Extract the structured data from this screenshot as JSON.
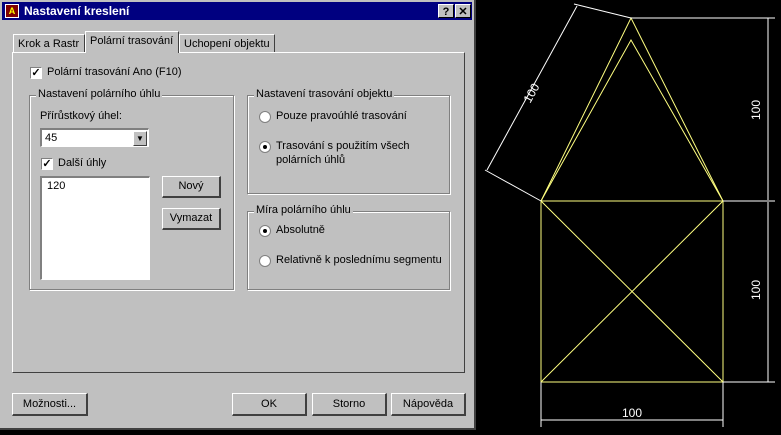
{
  "dialog": {
    "title": "Nastavení kreslení",
    "help_button": "?",
    "close_button": "✕",
    "tabs": [
      {
        "label": "Krok a Rastr",
        "active": false
      },
      {
        "label": "Polární trasování",
        "active": true
      },
      {
        "label": "Uchopení objektu",
        "active": false
      }
    ],
    "polar_tracking_on": {
      "label": "Polární trasování Ano (F10)",
      "checked": true
    },
    "polar_angle_group": {
      "title": "Nastavení polárního úhlu",
      "increment_label": "Přírůstkový úhel:",
      "increment_value": "45",
      "additional_angles": {
        "label": "Další úhly",
        "checked": true
      },
      "angles_list": [
        "120"
      ],
      "new_button": "Nový",
      "delete_button": "Vymazat"
    },
    "object_tracking_group": {
      "title": "Nastavení trasování objektu",
      "options": [
        {
          "label": "Pouze pravoúhlé trasování",
          "selected": false
        },
        {
          "label": "Trasování s použitím všech polárních úhlů",
          "line1": "Trasování s použitím všech",
          "line2": "polárních úhlů",
          "selected": true
        }
      ]
    },
    "polar_measure_group": {
      "title": "Míra polárního úhlu",
      "options": [
        {
          "label": "Absolutně",
          "selected": true
        },
        {
          "label": "Relativně k poslednímu segmentu",
          "selected": false
        }
      ]
    },
    "footer": {
      "options_button": "Možnosti...",
      "ok_button": "OK",
      "cancel_button": "Storno",
      "help_button": "Nápověda"
    }
  },
  "drawing": {
    "line_color": "#ffff80",
    "dim_color": "#ffffff",
    "background": "#000000",
    "dim_top_slanted": "100",
    "dim_right_upper": "100",
    "dim_right_lower": "100",
    "dim_bottom": "100"
  }
}
